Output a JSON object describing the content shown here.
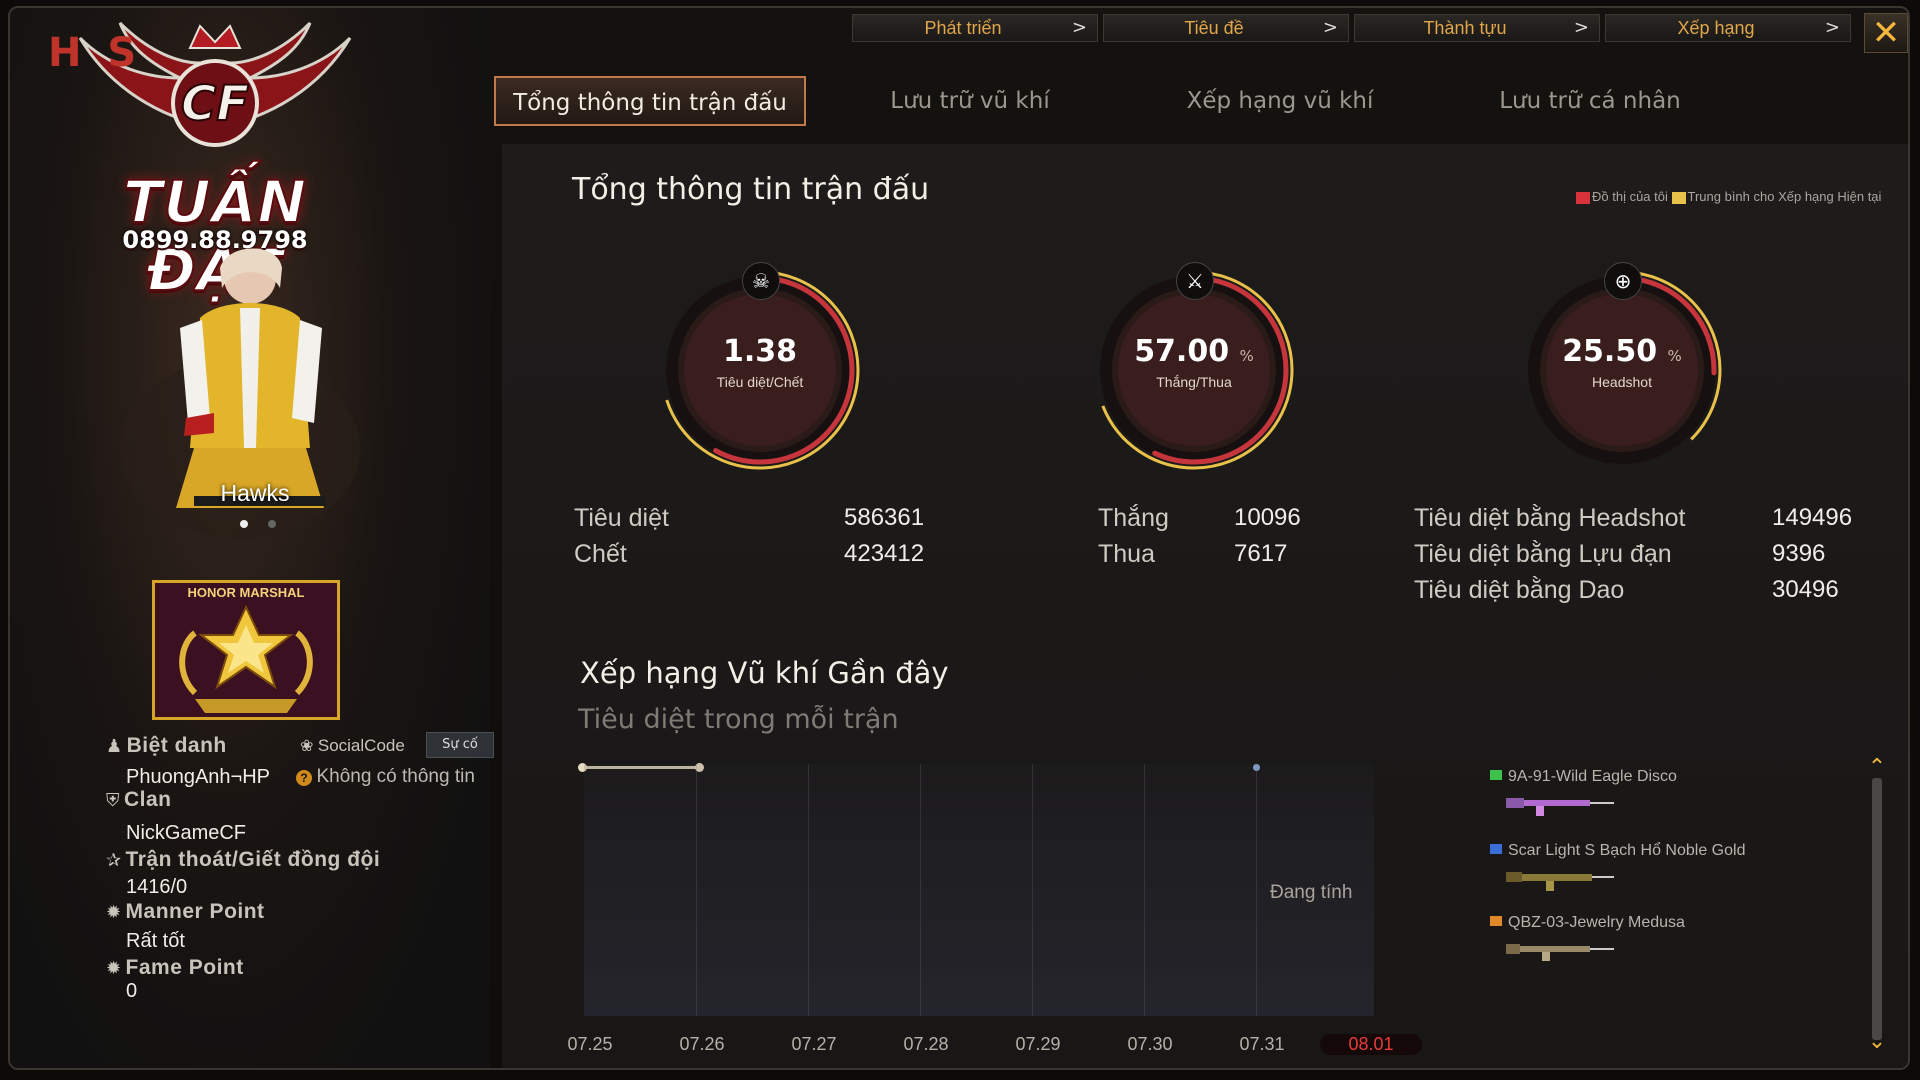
{
  "branding": {
    "watermark_letters": "H  S",
    "name": "TUẤN ĐẠT",
    "phone": "0899.88.9798"
  },
  "top_nav": [
    {
      "label": "Phát triển"
    },
    {
      "label": "Tiêu đề"
    },
    {
      "label": "Thành tựu"
    },
    {
      "label": "Xếp hạng"
    }
  ],
  "close_label": "✕",
  "tabs": [
    {
      "label": "Tổng thông tin trận đấu",
      "active": true
    },
    {
      "label": "Lưu trữ vũ khí",
      "active": false
    },
    {
      "label": "Xếp hạng vũ khí",
      "active": false
    },
    {
      "label": "Lưu trữ cá nhân",
      "active": false
    }
  ],
  "character": {
    "name": "Hawks",
    "rank_badge": "HONOR MARSHAL"
  },
  "profile": {
    "nickname_label": "Biệt danh",
    "nickname": "PhuongAnh¬HP",
    "social_label": "SocialCode",
    "social_button": "Sự cố",
    "social_value": "Không có thông tin",
    "clan_label": "Clan",
    "clan": "NickGameCF",
    "escape_label": "Trận thoát/Giết đồng đội",
    "escape_value": "1416/0",
    "manner_label": "Manner Point",
    "manner_value": "Rất tốt",
    "fame_label": "Fame Point",
    "fame_value": "0"
  },
  "overview": {
    "title": "Tổng thông tin trận đấu",
    "legend_mine": "Đồ thị của tôi",
    "legend_avg": "Trung bình cho Xếp hạng Hiện tại",
    "colors": {
      "mine": "#d8333a",
      "avg": "#e8c14a"
    }
  },
  "gauges": [
    {
      "value": "1.38",
      "unit": "",
      "caption": "Tiêu diệt/Chết",
      "icon": "skull-crossbones-icon",
      "fraction": 0.58
    },
    {
      "value": "57.00",
      "unit": "%",
      "caption": "Thắng/Thua",
      "icon": "crossed-swords-icon",
      "fraction": 0.57
    },
    {
      "value": "25.50",
      "unit": "%",
      "caption": "Headshot",
      "icon": "crosshair-icon",
      "fraction": 0.255
    }
  ],
  "stats": {
    "kills_label": "Tiêu diệt",
    "kills": "586361",
    "deaths_label": "Chết",
    "deaths": "423412",
    "wins_label": "Thắng",
    "wins": "10096",
    "losses_label": "Thua",
    "losses": "7617",
    "hs_label": "Tiêu diệt bằng Headshot",
    "hs": "149496",
    "grenade_label": "Tiêu diệt bằng Lựu đạn",
    "grenade": "9396",
    "knife_label": "Tiêu diệt bằng Dao",
    "knife": "30496"
  },
  "weapon_rank": {
    "title": "Xếp hạng Vũ khí Gần đây",
    "subtitle": "Tiêu diệt trong mỗi trận",
    "status": "Đang tính",
    "dates": [
      "07.25",
      "07.26",
      "07.27",
      "07.28",
      "07.29",
      "07.30",
      "07.31",
      "08.01"
    ],
    "selected_date": "08.01",
    "weapons": [
      {
        "name": "9A-91-Wild Eagle Disco",
        "color": "#3ec24a"
      },
      {
        "name": "Scar Light S Bạch Hổ Noble Gold",
        "color": "#3a6fd8"
      },
      {
        "name": "QBZ-03-Jewelry Medusa",
        "color": "#e0882a"
      }
    ]
  }
}
